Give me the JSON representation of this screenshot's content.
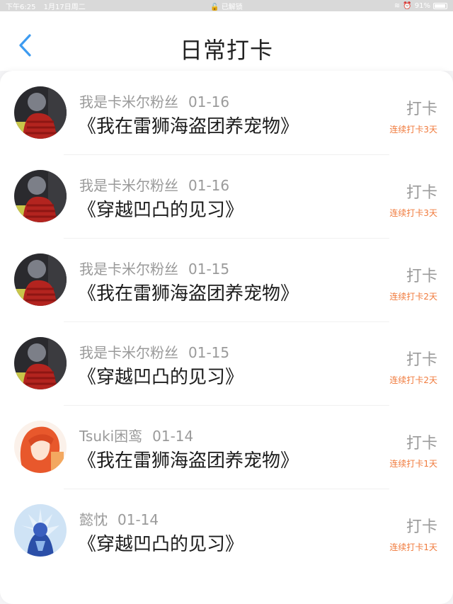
{
  "status": {
    "time": "下午6:25",
    "date": "1月17日周二",
    "center": "已解锁",
    "battery": "91%"
  },
  "header": {
    "title": "日常打卡",
    "back_icon": "chevron-left-icon"
  },
  "colors": {
    "accent": "#3d9bf0",
    "streak": "#f07a3c"
  },
  "entries": [
    {
      "user": "我是卡米尔粉丝",
      "date": "01-16",
      "book": "《我在雷狮海盗团养宠物》",
      "action": "打卡",
      "streak": "连续打卡3天",
      "avatar": "red-scarf-avatar"
    },
    {
      "user": "我是卡米尔粉丝",
      "date": "01-16",
      "book": "《穿越凹凸的见习》",
      "action": "打卡",
      "streak": "连续打卡3天",
      "avatar": "red-scarf-avatar"
    },
    {
      "user": "我是卡米尔粉丝",
      "date": "01-15",
      "book": "《我在雷狮海盗团养宠物》",
      "action": "打卡",
      "streak": "连续打卡2天",
      "avatar": "red-scarf-avatar"
    },
    {
      "user": "我是卡米尔粉丝",
      "date": "01-15",
      "book": "《穿越凹凸的见习》",
      "action": "打卡",
      "streak": "连续打卡2天",
      "avatar": "red-scarf-avatar"
    },
    {
      "user": "Tsuki困鸾",
      "date": "01-14",
      "book": "《我在雷狮海盗团养宠物》",
      "action": "打卡",
      "streak": "连续打卡1天",
      "avatar": "orange-hair-avatar"
    },
    {
      "user": "懿忱",
      "date": "01-14",
      "book": "《穿越凹凸的见习》",
      "action": "打卡",
      "streak": "连续打卡1天",
      "avatar": "blue-figure-avatar"
    }
  ]
}
